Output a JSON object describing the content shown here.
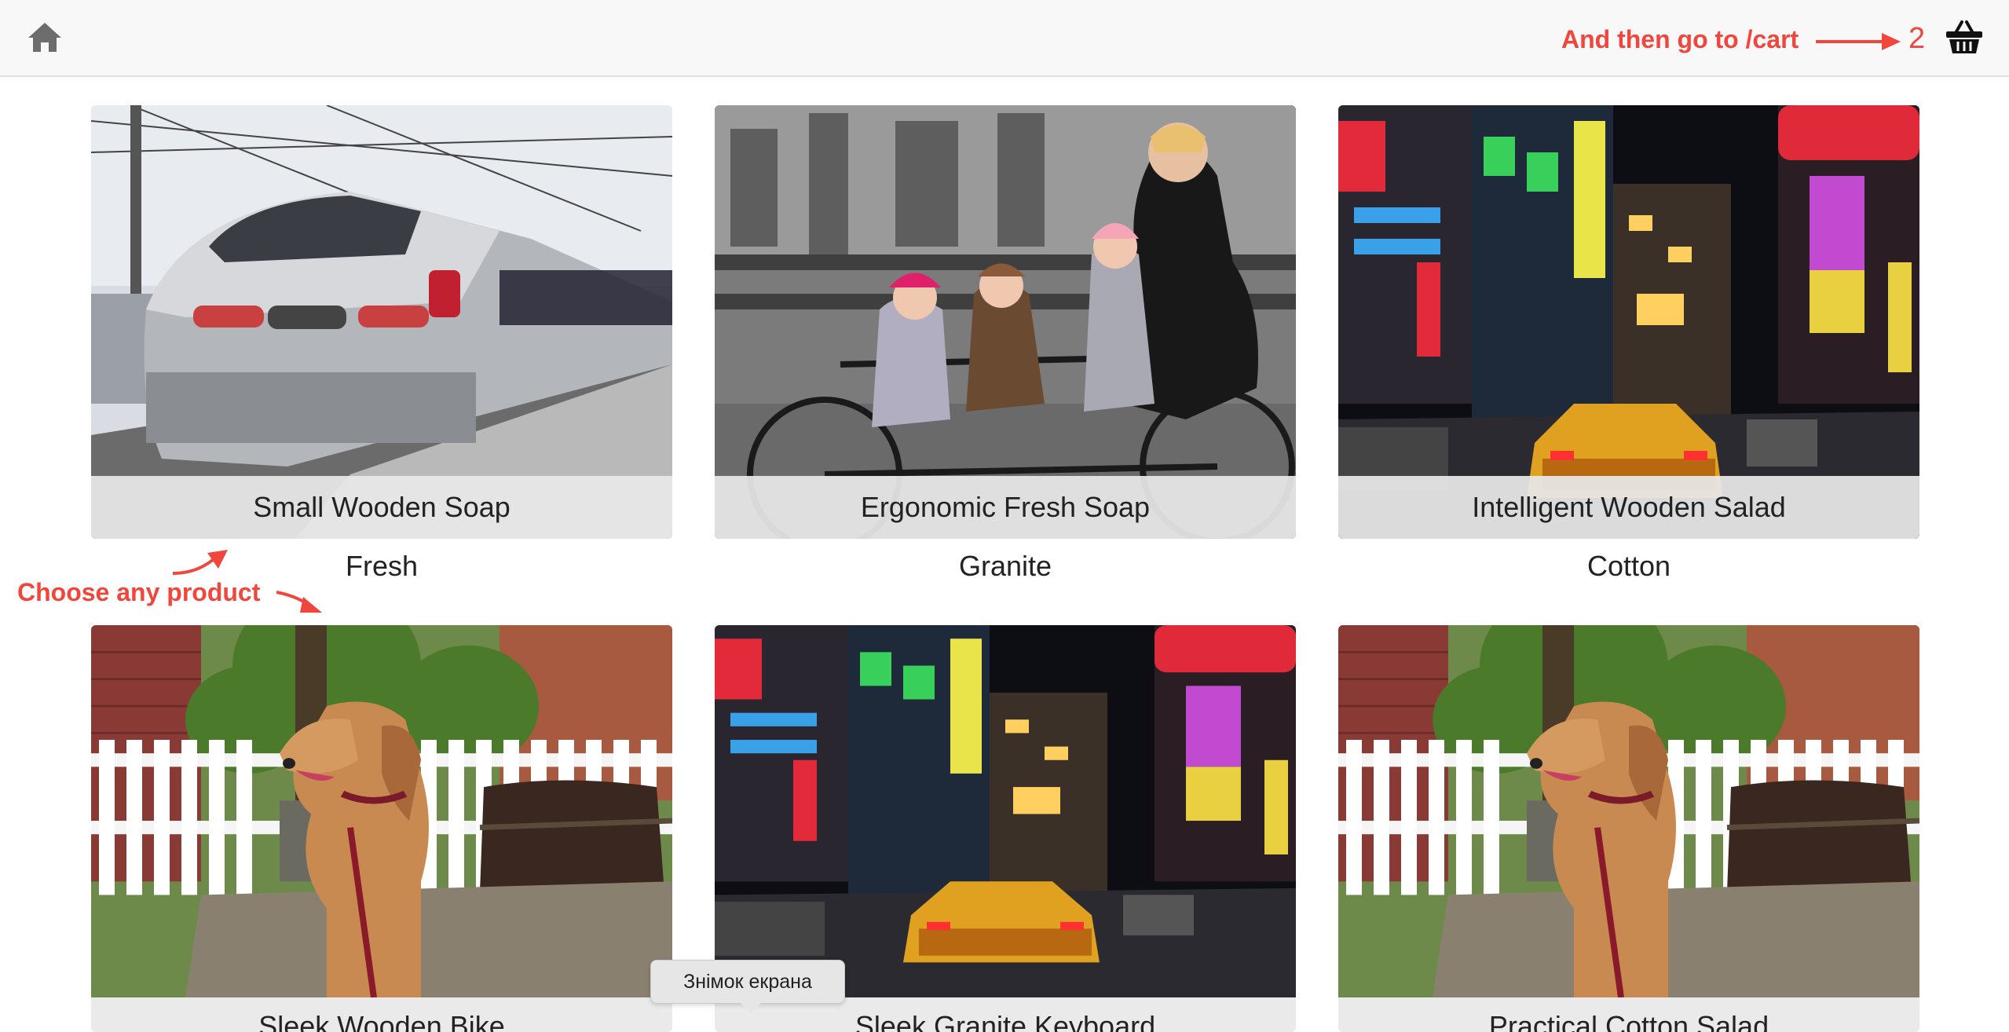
{
  "header": {
    "home_icon": "home-icon",
    "cart_hint": "And then go to /cart",
    "cart_count": "2",
    "cart_icon": "basket-icon",
    "accent_color": "#f0463c"
  },
  "annotation": {
    "choose_hint": "Choose any product"
  },
  "products": [
    {
      "name": "Small Wooden Soap",
      "material": "Fresh",
      "image": "high-speed-train-photo"
    },
    {
      "name": "Ergonomic Fresh Soap",
      "material": "Granite",
      "image": "family-tandem-bicycle-photo"
    },
    {
      "name": "Intelligent Wooden Salad",
      "material": "Cotton",
      "image": "neon-city-street-night-photo"
    },
    {
      "name": "Sleek Wooden Bike",
      "material": "",
      "image": "dog-by-picket-fence-photo"
    },
    {
      "name": "Sleek Granite Keyboard",
      "material": "",
      "image": "neon-city-street-night-photo"
    },
    {
      "name": "Practical Cotton Salad",
      "material": "",
      "image": "dog-by-picket-fence-photo"
    }
  ],
  "tooltip": {
    "text": "Знімок екрана"
  }
}
